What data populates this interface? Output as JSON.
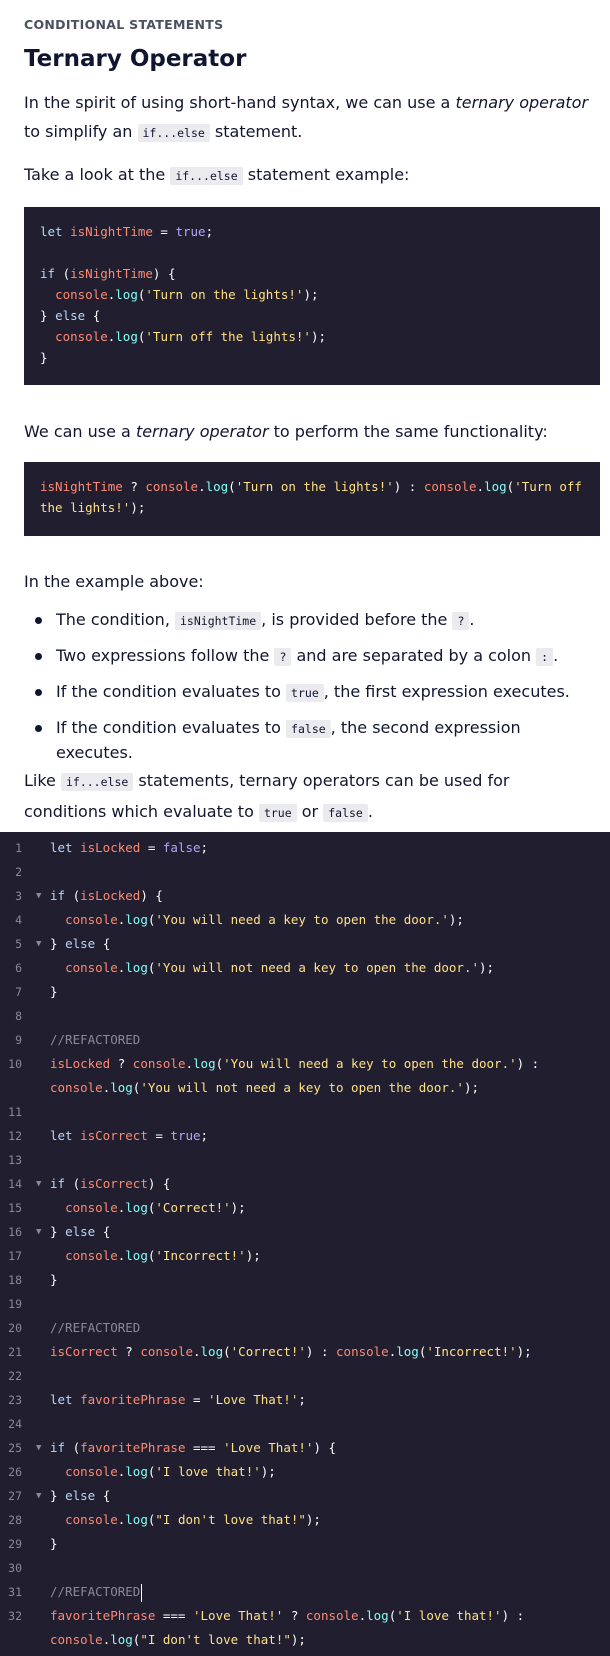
{
  "header": {
    "eyebrow": "CONDITIONAL STATEMENTS",
    "title": "Ternary Operator"
  },
  "intro": {
    "p1_a": "In the spirit of using short-hand syntax, we can use a ",
    "p1_em": "ternary operator",
    "p1_b": " to simplify an ",
    "p1_code": "if...else",
    "p1_c": " statement.",
    "p2_a": "Take a look at the ",
    "p2_code": "if...else",
    "p2_b": " statement example:"
  },
  "example1": {
    "l1_kw": "let",
    "l1_var": "isNightTime",
    "l1_eq": " = ",
    "l1_val": "true",
    "l1_end": ";",
    "l3_kw": "if",
    "l3_open": " (",
    "l3_var": "isNightTime",
    "l3_close": ") {",
    "l4_obj": "console",
    "l4_dot": ".",
    "l4_fn": "log",
    "l4_open": "(",
    "l4_str": "'Turn on the lights!'",
    "l4_end": ");",
    "l5_a": "} ",
    "l5_kw": "else",
    "l5_b": " {",
    "l6_obj": "console",
    "l6_dot": ".",
    "l6_fn": "log",
    "l6_open": "(",
    "l6_str": "'Turn off the lights!'",
    "l6_end": ");",
    "l7": "}"
  },
  "mid": {
    "p3_a": "We can use a ",
    "p3_em": "ternary operator",
    "p3_b": " to perform the same functionality:"
  },
  "example2": {
    "var": "isNightTime",
    "q": " ? ",
    "obj1": "console",
    "dot1": ".",
    "fn1": "log",
    "open1": "(",
    "str1": "'Turn on the lights!'",
    "close1": ")",
    "colon": " : ",
    "obj2": "console",
    "dot2": ".",
    "fn2": "log",
    "open2": "(",
    "str2": "'Turn off the lights!'",
    "end2": ");"
  },
  "explain": {
    "intro": "In the example above:",
    "b1_a": "The condition, ",
    "b1_code": "isNightTime",
    "b1_b": ", is provided before the ",
    "b1_code2": "?",
    "b1_c": ".",
    "b2_a": "Two expressions follow the ",
    "b2_code": "?",
    "b2_b": " and are separated by a colon ",
    "b2_code2": ":",
    "b2_c": ".",
    "b3_a": "If the condition evaluates to ",
    "b3_code": "true",
    "b3_b": ", the first expression executes.",
    "b4_a": "If the condition evaluates to ",
    "b4_code": "false",
    "b4_b": ", the second expression executes."
  },
  "closing": {
    "a": "Like ",
    "code1": "if...else",
    "b": " statements, ternary operators can be used for conditions which evaluate to ",
    "code2": "true",
    "c": " or ",
    "code3": "false",
    "d": "."
  },
  "editor": {
    "lines": [
      {
        "n": "1",
        "fold": false
      },
      {
        "n": "2",
        "fold": false
      },
      {
        "n": "3",
        "fold": true
      },
      {
        "n": "4",
        "fold": false
      },
      {
        "n": "5",
        "fold": true
      },
      {
        "n": "6",
        "fold": false
      },
      {
        "n": "7",
        "fold": false
      },
      {
        "n": "8",
        "fold": false
      },
      {
        "n": "9",
        "fold": false
      },
      {
        "n": "10",
        "fold": false
      },
      {
        "n": "11",
        "fold": false
      },
      {
        "n": "12",
        "fold": false
      },
      {
        "n": "13",
        "fold": false
      },
      {
        "n": "14",
        "fold": true
      },
      {
        "n": "15",
        "fold": false
      },
      {
        "n": "16",
        "fold": true
      },
      {
        "n": "17",
        "fold": false
      },
      {
        "n": "18",
        "fold": false
      },
      {
        "n": "19",
        "fold": false
      },
      {
        "n": "20",
        "fold": false
      },
      {
        "n": "21",
        "fold": false
      },
      {
        "n": "22",
        "fold": false
      },
      {
        "n": "23",
        "fold": false
      },
      {
        "n": "24",
        "fold": false
      },
      {
        "n": "25",
        "fold": true
      },
      {
        "n": "26",
        "fold": false
      },
      {
        "n": "27",
        "fold": true
      },
      {
        "n": "28",
        "fold": false
      },
      {
        "n": "29",
        "fold": false
      },
      {
        "n": "30",
        "fold": false
      },
      {
        "n": "31",
        "fold": false
      },
      {
        "n": "32",
        "fold": false
      }
    ],
    "fold_glyph": "▼",
    "t_let": "let",
    "t_if": "if",
    "t_else": "else",
    "t_console": "console",
    "t_log": "log",
    "t_false": "false",
    "t_true": "true",
    "isLocked": "isLocked",
    "isCorrect": "isCorrect",
    "favoritePhrase": "favoritePhrase",
    "s_need": "'You will need a key to open the door.'",
    "s_notneed": "'You will not need a key to open the door.'",
    "s_correct": "'Correct!'",
    "s_incorrect": "'Incorrect!'",
    "s_lovethat": "'Love That!'",
    "s_ilove": "'I love that!'",
    "s_dontlove": "\"I don't love that!\"",
    "comment": "//REFACTORED"
  }
}
